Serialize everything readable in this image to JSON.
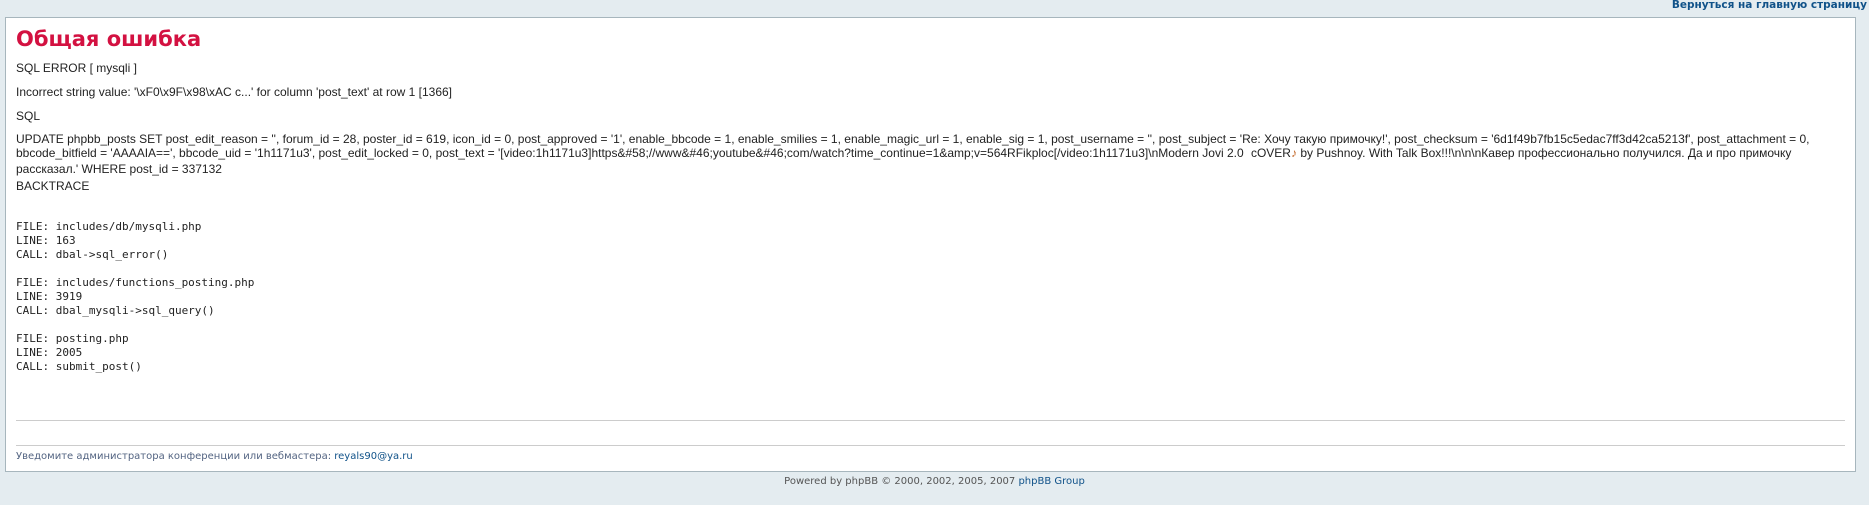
{
  "header": {
    "return_link": "Вернуться на главную страницу"
  },
  "error": {
    "title": "Общая ошибка",
    "sql_error_label": "SQL ERROR [ mysqli ]",
    "message": "Incorrect string value: '\\xF0\\x9F\\x98\\xAC c...' for column 'post_text' at row 1 [1366]",
    "sql_label": "SQL",
    "sql_part1": "UPDATE phpbb_posts SET post_edit_reason = '', forum_id = 28, poster_id = 619, icon_id = 0, post_approved = '1', enable_bbcode = 1, enable_smilies = 1, enable_magic_url = 1, enable_sig = 1, post_username = '', post_subject = 'Re: Хочу такую примочку!', post_checksum = '6d1f49b7fb15c5edac7ff3d42ca5213f', post_attachment = 0, bbcode_bitfield = 'AAAAIA==', bbcode_uid = '1h1171u3', post_edit_locked = 0, post_text = '[video:1h1171u3]https&#58;//www&#46;youtube&#46;com/watch?time_continue=1&amp;v=564RFikploc[/video:1h1171u3]\\nModern Jovi 2.0",
    "sql_part2": "cOVER",
    "sql_part3": "by Pushnoy. With Talk Box!!!\\n\\n\\nКавер профессионально получился. Да и про примочку рассказал.' WHERE post_id = 337132",
    "backtrace_label": "BACKTRACE",
    "backtrace": [
      {
        "file": "FILE: includes/db/mysqli.php",
        "line": "LINE: 163",
        "call": "CALL: dbal->sql_error()"
      },
      {
        "file": "FILE: includes/functions_posting.php",
        "line": "LINE: 3919",
        "call": "CALL: dbal_mysqli->sql_query()"
      },
      {
        "file": "FILE: posting.php",
        "line": "LINE: 2005",
        "call": "CALL: submit_post()"
      }
    ]
  },
  "notify": {
    "text": "Уведомите администратора конференции или вебмастера: ",
    "email": "reyals90@ya.ru"
  },
  "footer": {
    "text": "Powered by phpBB © 2000, 2002, 2005, 2007 ",
    "link": "phpBB Group"
  },
  "icons": {
    "grimace": "grimacing-emoji-icon",
    "guitar": "guitar-emoji-icon"
  }
}
